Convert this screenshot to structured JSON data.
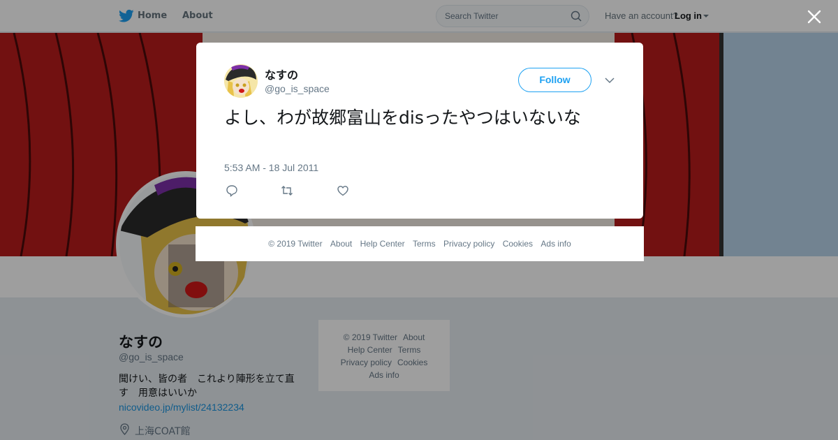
{
  "nav": {
    "home_label": "Home",
    "about_label": "About",
    "search_placeholder": "Search Twitter",
    "have_account": "Have an account?",
    "login_label": "Log in"
  },
  "profile": {
    "name": "なすの",
    "handle": "@go_is_space",
    "bio": "聞けい、皆の者　これより陣形を立て直す　用意はいいか",
    "link": "nicovideo.jp/mylist/24132234",
    "location": "上海COAT館"
  },
  "side_footer": {
    "copyright": "© 2019 Twitter",
    "about": "About",
    "help": "Help Center",
    "terms": "Terms",
    "privacy": "Privacy policy",
    "cookies": "Cookies",
    "ads": "Ads info"
  },
  "tweet": {
    "name": "なすの",
    "handle": "@go_is_space",
    "follow_label": "Follow",
    "text": "よし、わが故郷富山をdisったやつはいないな",
    "timestamp": "5:53 AM - 18 Jul 2011"
  },
  "modal_footer": {
    "copyright": "© 2019 Twitter",
    "about": "About",
    "help": "Help Center",
    "terms": "Terms",
    "privacy": "Privacy policy",
    "cookies": "Cookies",
    "ads": "Ads info"
  },
  "colors": {
    "accent": "#1da1f2",
    "link": "#1b95e0",
    "muted": "#657786",
    "overlay": "rgba(0,0,0,0.38)"
  },
  "icons": [
    "twitter-bird-icon",
    "search-icon",
    "caret-down-icon",
    "close-icon",
    "reply-icon",
    "retweet-icon",
    "like-icon",
    "location-icon"
  ]
}
